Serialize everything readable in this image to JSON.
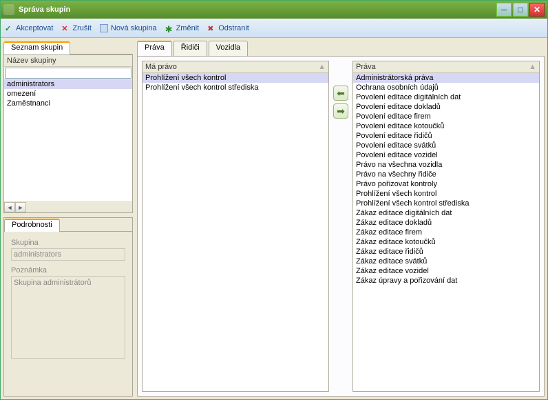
{
  "window": {
    "title": "Správa skupin"
  },
  "toolbar": {
    "accept": "Akceptovat",
    "cancel": "Zrušit",
    "new": "Nová skupina",
    "edit": "Změnit",
    "delete": "Odstranit"
  },
  "left_tabs": {
    "list": "Seznam skupin",
    "details": "Podrobnosti"
  },
  "groups": {
    "header": "Název skupiny",
    "items": [
      "administrators",
      "omezení",
      "Zaměstnanci"
    ],
    "selected": 0
  },
  "details": {
    "skupina_label": "Skupina",
    "skupina_value": "administrators",
    "poznamka_label": "Poznámka",
    "poznamka_value": "Skupina administrátorů"
  },
  "right_tabs": [
    "Práva",
    "Řidiči",
    "Vozidla"
  ],
  "assigned": {
    "header": "Má právo",
    "items": [
      "Prohlížení všech kontrol",
      "Prohlížení všech kontrol střediska"
    ]
  },
  "available": {
    "header": "Práva",
    "items": [
      "Administrátorská práva",
      "Ochrana osobních údajů",
      "Povolení editace digitálních dat",
      "Povolení editace dokladů",
      "Povolení editace firem",
      "Povolení editace kotoučků",
      "Povolení editace řidičů",
      "Povolení editace svátků",
      "Povolení editace vozidel",
      "Právo na všechna vozidla",
      "Právo na všechny řidiče",
      "Právo pořizovat kontroly",
      "Prohlížení všech kontrol",
      "Prohlížení všech kontrol střediska",
      "Zákaz editace digitálních dat",
      "Zákaz editace dokladů",
      "Zákaz editace firem",
      "Zákaz editace kotoučků",
      "Zákaz editace řidičů",
      "Zákaz editace svátků",
      "Zákaz editace vozidel",
      "Zákaz úpravy a pořizování dat"
    ]
  }
}
